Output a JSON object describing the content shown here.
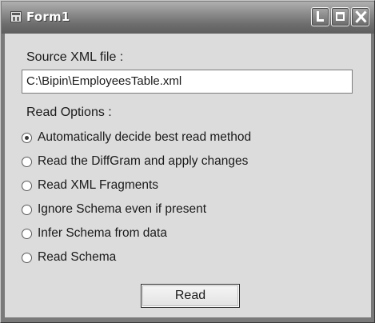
{
  "window": {
    "title": "Form1",
    "controls": {
      "minimize_icon": "minimize-icon",
      "maximize_icon": "maximize-icon",
      "close_icon": "close-icon"
    }
  },
  "form": {
    "source_label": "Source XML file :",
    "source_value": "C:\\Bipin\\EmployeesTable.xml",
    "options_label": "Read Options :",
    "options": [
      {
        "label": "Automatically decide best read method",
        "checked": true
      },
      {
        "label": "Read the DiffGram and apply changes",
        "checked": false
      },
      {
        "label": "Read XML Fragments",
        "checked": false
      },
      {
        "label": "Ignore Schema even if present",
        "checked": false
      },
      {
        "label": "Infer Schema from data",
        "checked": false
      },
      {
        "label": "Read Schema",
        "checked": false
      }
    ],
    "read_button_label": "Read"
  }
}
